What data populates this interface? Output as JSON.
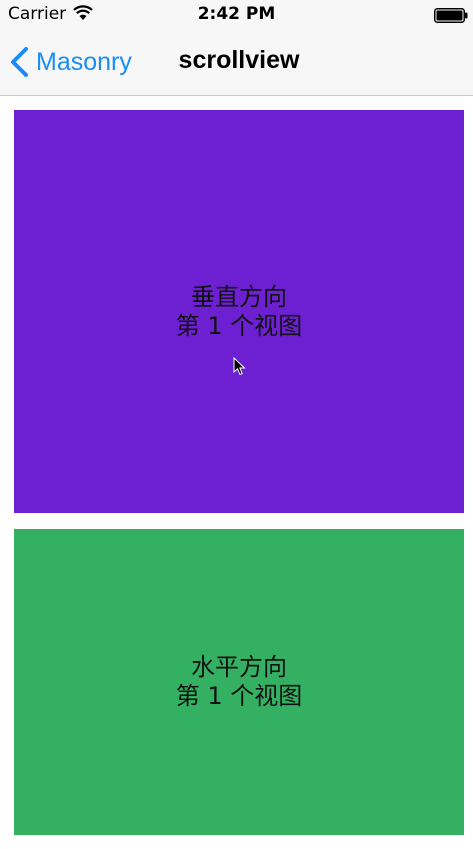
{
  "status_bar": {
    "carrier": "Carrier",
    "time": "2:42 PM",
    "wifi_icon": "wifi-icon",
    "battery_icon": "battery-icon"
  },
  "nav": {
    "back_label": "Masonry",
    "back_icon": "chevron-left-icon",
    "title": "scrollview",
    "tint_color": "#1a8cf5",
    "bar_color": "#f7f7f7"
  },
  "panels": [
    {
      "line1": "垂直方向",
      "line2": "第 1 个视图",
      "color": "#6d20d1"
    },
    {
      "line1": "水平方向",
      "line2": "第 1 个视图",
      "color": "#34b063"
    }
  ]
}
